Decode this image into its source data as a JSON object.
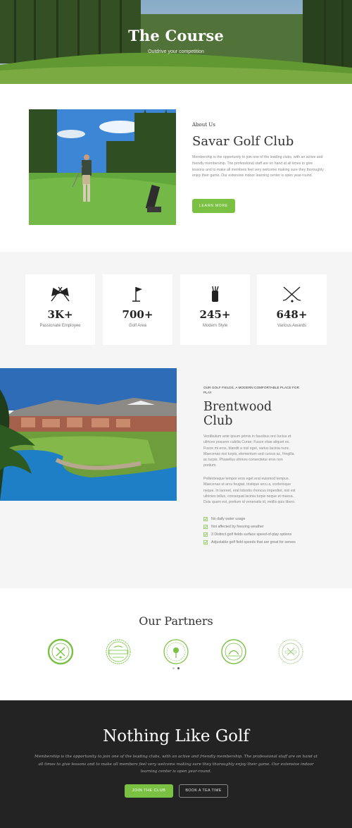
{
  "hero": {
    "title": "The Course",
    "subtitle": "Outdrive your competition"
  },
  "about": {
    "eyebrow": "About Us",
    "title": "Savar Golf Club",
    "description": "Membership is the opportunity to join one of the leading clubs, with an active and friendly membership. The professional staff are on hand at all times to give lessons and to make all members feel very welcome making sure they thoroughly enjoy their game. Our extensive indoor learning center is open year-round.",
    "button_label": "LEARN MORE"
  },
  "stats": [
    {
      "icon": "crossed-flags-icon",
      "number": "3K+",
      "label": "Passionate Employee"
    },
    {
      "icon": "golf-flag-icon",
      "number": "700+",
      "label": "Golf Area"
    },
    {
      "icon": "golf-bag-icon",
      "number": "245+",
      "label": "Modern Style"
    },
    {
      "icon": "crossed-clubs-icon",
      "number": "648+",
      "label": "Various Awards"
    }
  ],
  "brentwood": {
    "eyebrow": "OUR GOLF FIELDS, A MODERN COMFORTABLE PLACE FOR PLAY",
    "title": "Brentwood Club",
    "paragraph1": "Vestibulum ante ipsum primis in faucibus orci luctus et ultrices posuere cubilia Curae; Fusce vitae aliquet ex. Fusce mi eros, blandit a nisl eget, varius lacinia nunc. Maecenas nisi turpis, elementum sed cursus ac, fringilla ac turpis. Phasellus ultrices consectetur eros non pretium.",
    "paragraph2": "Pellentesque tempor eros eget erat euismod tempus. Maecenas ut arcu feugiat, tristique arcu a, scelerisque neque. In laoreet, erat lobortis rhoncus imperdiet, nisl est ultricies tellus, consequat lacinia turpis neque et massa. Duis quam est, pretium id venenatis id, mollis quis libero.",
    "features": [
      "No daily water usage",
      "Not affected by freezing weather",
      "3 Distinct golf fields surface speed-of-play options",
      "Adjustable golf field speeds that are great for serves"
    ]
  },
  "partners": {
    "title": "Our Partners",
    "logos": [
      "partner-logo-1",
      "partner-logo-2",
      "partner-logo-3",
      "partner-logo-4",
      "partner-logo-5"
    ]
  },
  "cta": {
    "title": "Nothing Like Golf",
    "description": "Membership is the opportunity to join one of the leading clubs, with an active and friendly membership. The professional staff are on hand at all times to give lessons and to make all members feel very welcome making sure they thoroughly enjoy their game. Our extensive indoor learning center is open year-round.",
    "join_label": "JOIN THE CLUB",
    "book_label": "BOOK A TEA TIME"
  },
  "colors": {
    "accent": "#7ac143",
    "dark": "#232323",
    "light_bg": "#f5f5f5"
  }
}
